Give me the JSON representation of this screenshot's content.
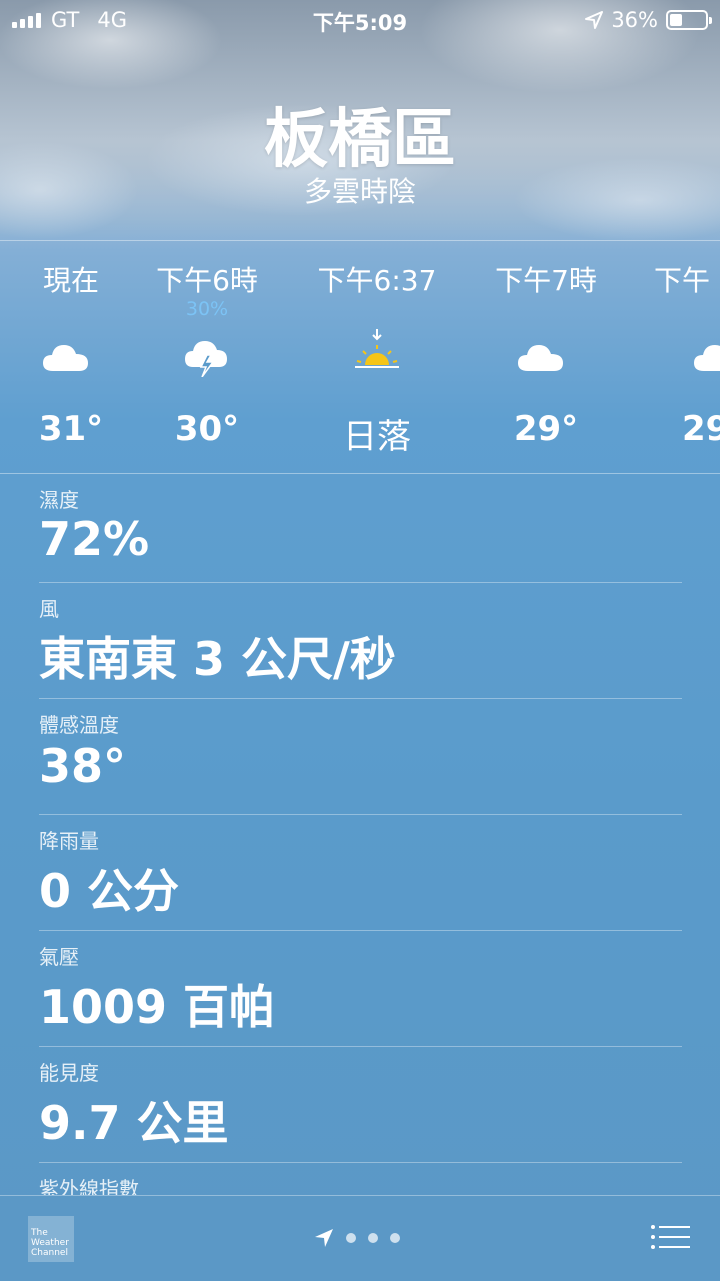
{
  "status_bar": {
    "carrier": "GT",
    "network": "4G",
    "time": "下午5:09",
    "battery": "36%",
    "battery_level": 0.36
  },
  "location": {
    "city": "板橋區",
    "condition": "多雲時陰"
  },
  "hourly": [
    {
      "time": "現在",
      "precip": "",
      "icon": "cloud-icon",
      "temp": "31°"
    },
    {
      "time": "下午6時",
      "precip": "30%",
      "icon": "thunderstorm-icon",
      "temp": "30°"
    },
    {
      "time": "下午6:37",
      "precip": "",
      "icon": "sunset-icon",
      "temp": "日落"
    },
    {
      "time": "下午7時",
      "precip": "",
      "icon": "cloud-icon",
      "temp": "29°"
    },
    {
      "time": "下午",
      "precip": "",
      "icon": "cloud-icon",
      "temp": "29"
    }
  ],
  "details": [
    {
      "label": "濕度",
      "value": "72%"
    },
    {
      "label": "風",
      "value": "東南東 3 公尺/秒"
    },
    {
      "label": "體感溫度",
      "value": "38°"
    },
    {
      "label": "降雨量",
      "value": "0 公分"
    },
    {
      "label": "氣壓",
      "value": "1009 百帕"
    },
    {
      "label": "能見度",
      "value": "9.7 公里"
    },
    {
      "label": "紫外線指數",
      "value": ""
    }
  ],
  "footer": {
    "logo_text": "The Weather Channel",
    "page_indicator": [
      "location-arrow-icon",
      "dot",
      "dot",
      "dot"
    ],
    "menu_icon": "list-icon"
  }
}
